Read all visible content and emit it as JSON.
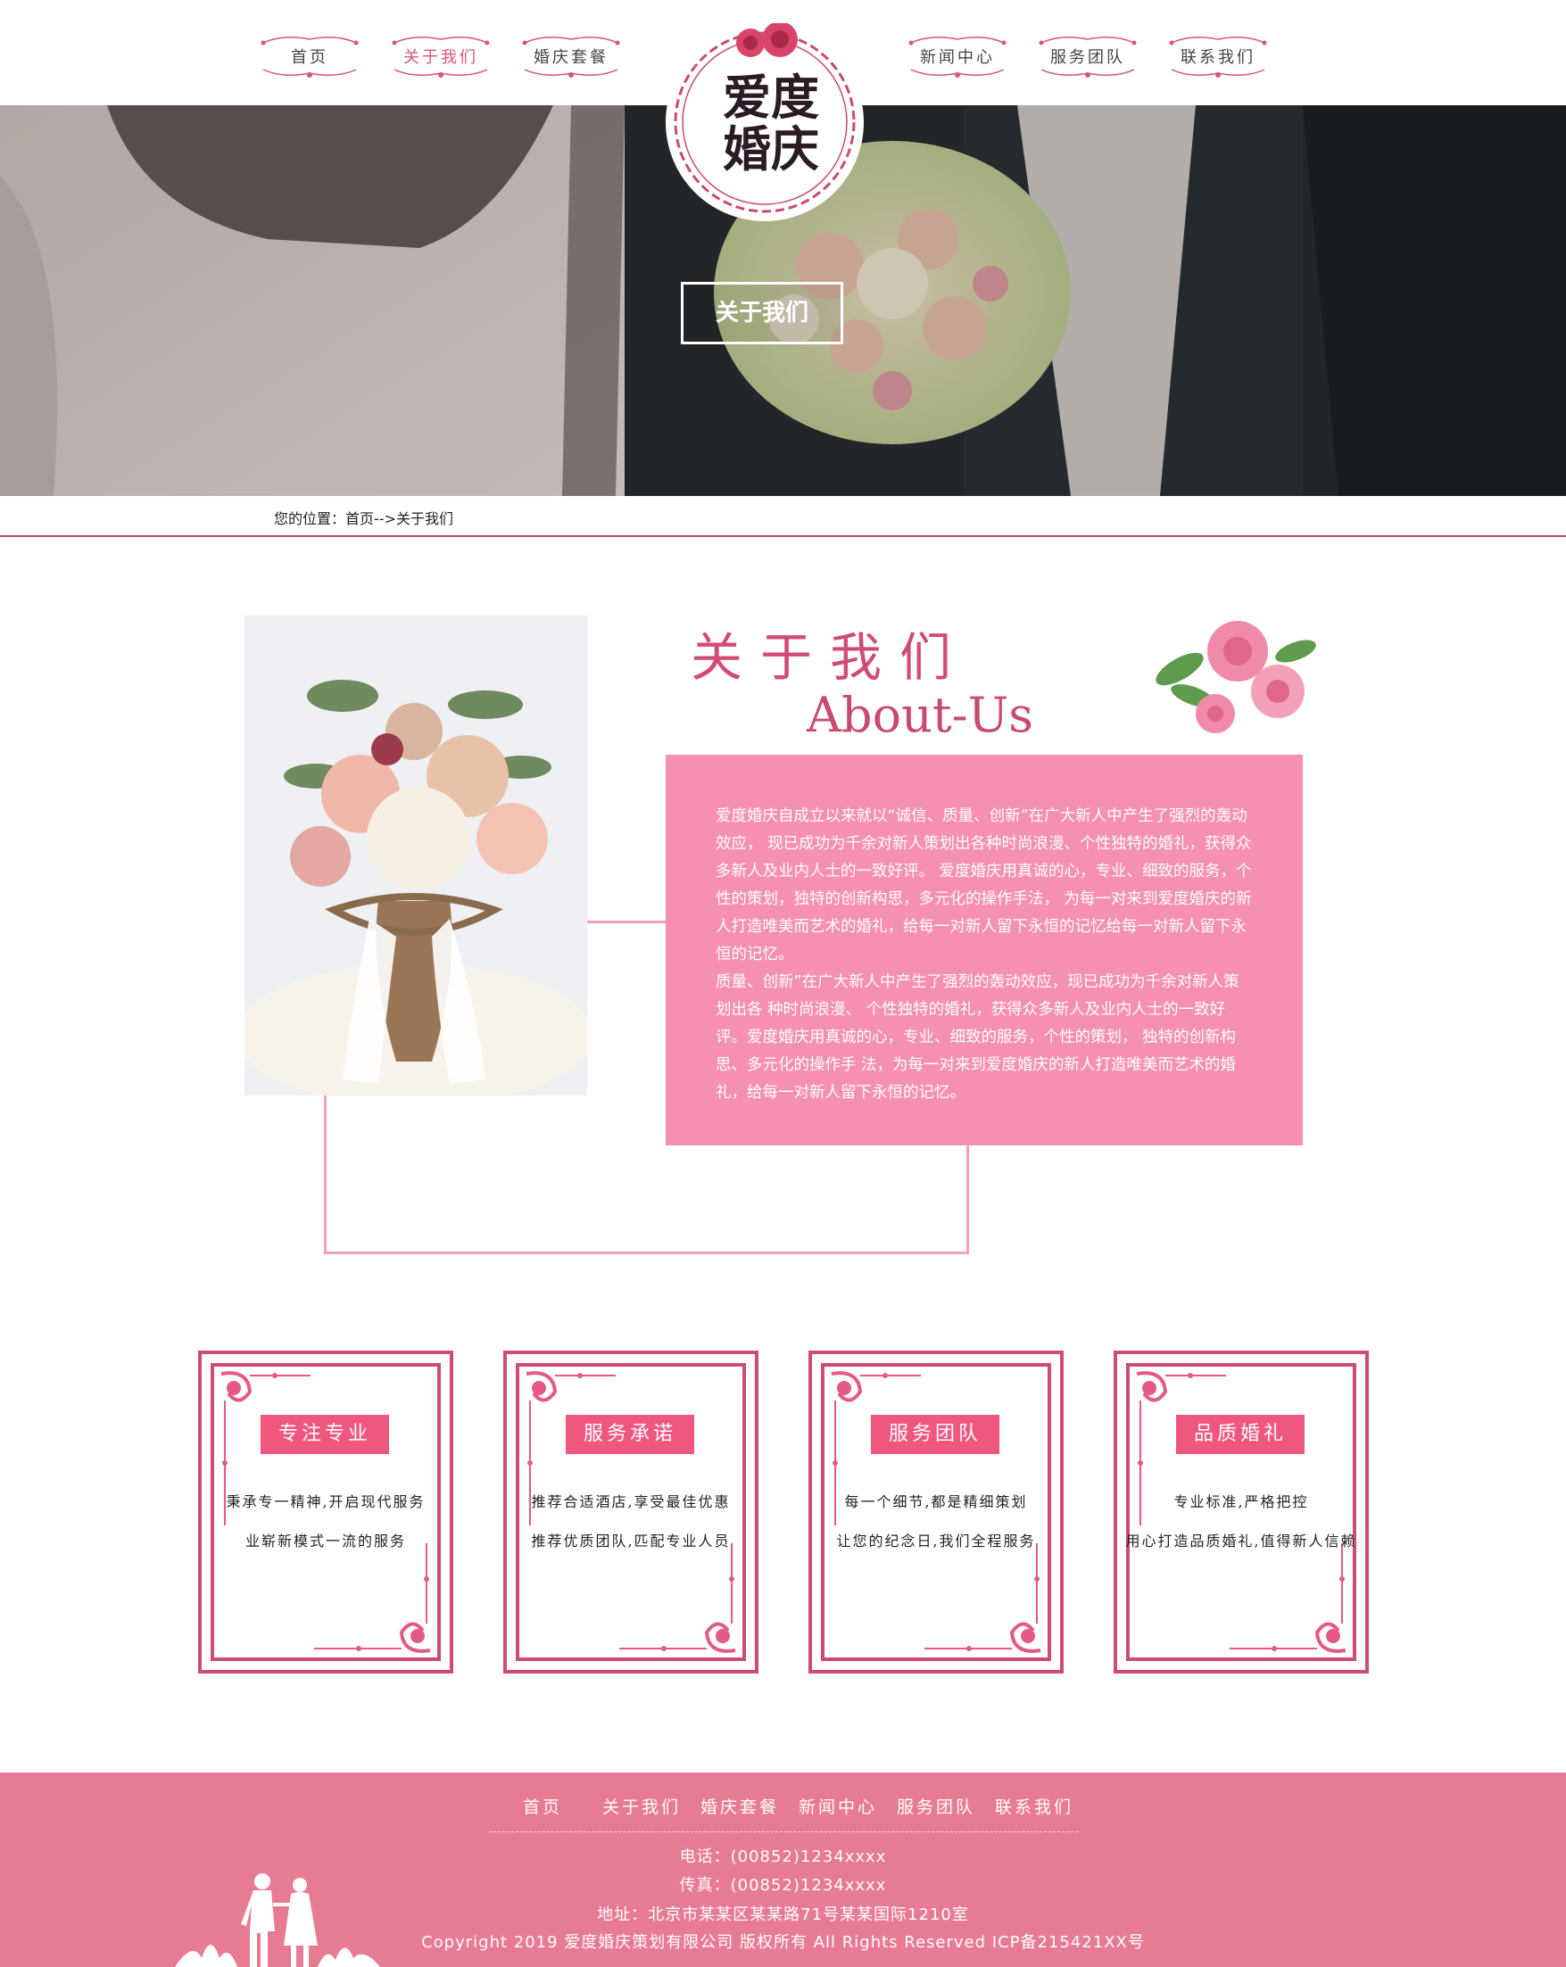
{
  "nav": {
    "left": [
      {
        "label": "首页"
      },
      {
        "label": "关于我们"
      },
      {
        "label": "婚庆套餐"
      }
    ],
    "right": [
      {
        "label": "新闻中心"
      },
      {
        "label": "服务团队"
      },
      {
        "label": "联系我们"
      }
    ],
    "active": "关于我们"
  },
  "logo": {
    "line1": "爱度",
    "line2": "婚庆"
  },
  "banner": {
    "cta": "关于我们"
  },
  "breadcrumb": {
    "prefix": "您的位置：",
    "home": "首页",
    "sep": "-->",
    "current": "关于我们"
  },
  "about": {
    "title_cn": "关于我们",
    "title_en": "About-Us",
    "paragraph1": "爱度婚庆自成立以来就以“诚信、质量、创新”在广大新人中产生了强烈的轰动效应， 现已成功为千余对新人策划出各种时尚浪漫、个性独特的婚礼，获得众多新人及业内人士的一致好评。 爱度婚庆用真诚的心，专业、细致的服务，个性的策划，独特的创新构思，多元化的操作手法， 为每一对来到爱度婚庆的新人打造唯美而艺术的婚礼，给每一对新人留下永恒的记忆给每一对新人留下永恒的记忆。",
    "paragraph2": "质量、创新”在广大新人中产生了强烈的轰动效应，现已成功为千余对新人策划出各 种时尚浪漫、 个性独特的婚礼，获得众多新人及业内人士的一致好评。爱度婚庆用真诚的心，专业、细致的服务，个性的策划， 独特的创新构思、多元化的操作手 法，为每一对来到爱度婚庆的新人打造唯美而艺术的婚礼，给每一对新人留下永恒的记忆。"
  },
  "cards": [
    {
      "title": "专注专业",
      "line1": "秉承专一精神,开启现代服务",
      "line2": "业崭新模式一流的服务"
    },
    {
      "title": "服务承诺",
      "line1": "推荐合适酒店,享受最佳优惠",
      "line2": "推荐优质团队,匹配专业人员"
    },
    {
      "title": "服务团队",
      "line1": "每一个细节,都是精细策划",
      "line2": "让您的纪念日,我们全程服务"
    },
    {
      "title": "品质婚礼",
      "line1": "专业标准,严格把控",
      "line2": "用心打造品质婚礼,值得新人信赖"
    }
  ],
  "footer": {
    "nav": [
      "首页",
      "关于我们",
      "婚庆套餐",
      "新闻中心",
      "服务团队",
      "联系我们"
    ],
    "phone": "电话：(00852)1234xxxx",
    "fax": "传真：(00852)1234xxxx",
    "address": "地址：北京市某某区某某路71号某某国际1210室",
    "copyright": "Copyright 2019 爱度婚庆策划有限公司 版权所有 All Rights Reserved ICP备215421XX号"
  },
  "colors": {
    "accent": "#d14b73",
    "pink_box": "#f590b0",
    "footer": "#e87b94",
    "card_border": "#cf4b73"
  }
}
